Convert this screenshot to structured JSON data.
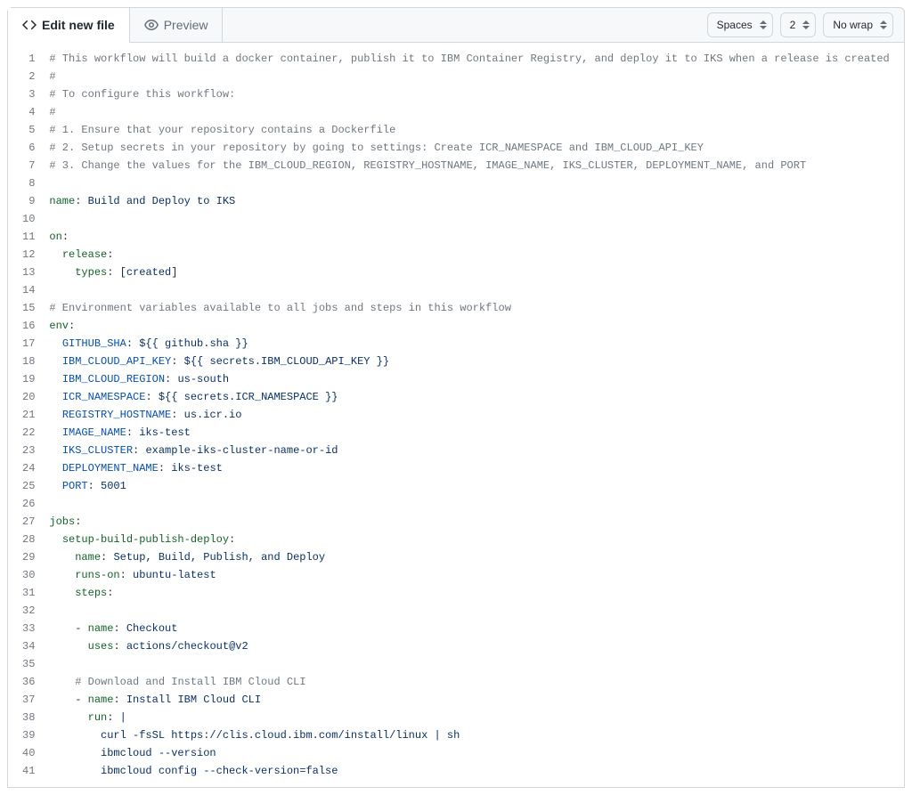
{
  "toolbar": {
    "editTab": "Edit new file",
    "previewTab": "Preview",
    "indentMode": "Spaces",
    "indentSize": "2",
    "wrapMode": "No wrap"
  },
  "code": {
    "lines": [
      [
        [
          "comment",
          "# This workflow will build a docker container, publish it to IBM Container Registry, and deploy it to IKS when a release is created"
        ]
      ],
      [
        [
          "comment",
          "#"
        ]
      ],
      [
        [
          "comment",
          "# To configure this workflow:"
        ]
      ],
      [
        [
          "comment",
          "#"
        ]
      ],
      [
        [
          "comment",
          "# 1. Ensure that your repository contains a Dockerfile"
        ]
      ],
      [
        [
          "comment",
          "# 2. Setup secrets in your repository by going to settings: Create ICR_NAMESPACE and IBM_CLOUD_API_KEY"
        ]
      ],
      [
        [
          "comment",
          "# 3. Change the values for the IBM_CLOUD_REGION, REGISTRY_HOSTNAME, IMAGE_NAME, IKS_CLUSTER, DEPLOYMENT_NAME, and PORT"
        ]
      ],
      [],
      [
        [
          "key",
          "name"
        ],
        [
          "punc",
          ": "
        ],
        [
          "str",
          "Build and Deploy to IKS"
        ]
      ],
      [],
      [
        [
          "key",
          "on"
        ],
        [
          "punc",
          ":"
        ]
      ],
      [
        [
          "punc",
          "  "
        ],
        [
          "key",
          "release"
        ],
        [
          "punc",
          ":"
        ]
      ],
      [
        [
          "punc",
          "    "
        ],
        [
          "key",
          "types"
        ],
        [
          "punc",
          ": ["
        ],
        [
          "str",
          "created"
        ],
        [
          "punc",
          "]"
        ]
      ],
      [],
      [
        [
          "comment",
          "# Environment variables available to all jobs and steps in this workflow"
        ]
      ],
      [
        [
          "key",
          "env"
        ],
        [
          "punc",
          ":"
        ]
      ],
      [
        [
          "punc",
          "  "
        ],
        [
          "var",
          "GITHUB_SHA"
        ],
        [
          "punc",
          ": "
        ],
        [
          "str",
          "${{ github.sha }}"
        ]
      ],
      [
        [
          "punc",
          "  "
        ],
        [
          "var",
          "IBM_CLOUD_API_KEY"
        ],
        [
          "punc",
          ": "
        ],
        [
          "str",
          "${{ secrets.IBM_CLOUD_API_KEY }}"
        ]
      ],
      [
        [
          "punc",
          "  "
        ],
        [
          "var",
          "IBM_CLOUD_REGION"
        ],
        [
          "punc",
          ": "
        ],
        [
          "str",
          "us-south"
        ]
      ],
      [
        [
          "punc",
          "  "
        ],
        [
          "var",
          "ICR_NAMESPACE"
        ],
        [
          "punc",
          ": "
        ],
        [
          "str",
          "${{ secrets.ICR_NAMESPACE }}"
        ]
      ],
      [
        [
          "punc",
          "  "
        ],
        [
          "var",
          "REGISTRY_HOSTNAME"
        ],
        [
          "punc",
          ": "
        ],
        [
          "str",
          "us.icr.io"
        ]
      ],
      [
        [
          "punc",
          "  "
        ],
        [
          "var",
          "IMAGE_NAME"
        ],
        [
          "punc",
          ": "
        ],
        [
          "str",
          "iks-test"
        ]
      ],
      [
        [
          "punc",
          "  "
        ],
        [
          "var",
          "IKS_CLUSTER"
        ],
        [
          "punc",
          ": "
        ],
        [
          "str",
          "example-iks-cluster-name-or-id"
        ]
      ],
      [
        [
          "punc",
          "  "
        ],
        [
          "var",
          "DEPLOYMENT_NAME"
        ],
        [
          "punc",
          ": "
        ],
        [
          "str",
          "iks-test"
        ]
      ],
      [
        [
          "punc",
          "  "
        ],
        [
          "var",
          "PORT"
        ],
        [
          "punc",
          ": "
        ],
        [
          "str",
          "5001"
        ]
      ],
      [],
      [
        [
          "key",
          "jobs"
        ],
        [
          "punc",
          ":"
        ]
      ],
      [
        [
          "punc",
          "  "
        ],
        [
          "key",
          "setup-build-publish-deploy"
        ],
        [
          "punc",
          ":"
        ]
      ],
      [
        [
          "punc",
          "    "
        ],
        [
          "key",
          "name"
        ],
        [
          "punc",
          ": "
        ],
        [
          "str",
          "Setup, Build, Publish, and Deploy"
        ]
      ],
      [
        [
          "punc",
          "    "
        ],
        [
          "key",
          "runs-on"
        ],
        [
          "punc",
          ": "
        ],
        [
          "str",
          "ubuntu-latest"
        ]
      ],
      [
        [
          "punc",
          "    "
        ],
        [
          "key",
          "steps"
        ],
        [
          "punc",
          ":"
        ]
      ],
      [],
      [
        [
          "punc",
          "    - "
        ],
        [
          "key",
          "name"
        ],
        [
          "punc",
          ": "
        ],
        [
          "str",
          "Checkout"
        ]
      ],
      [
        [
          "punc",
          "      "
        ],
        [
          "key",
          "uses"
        ],
        [
          "punc",
          ": "
        ],
        [
          "str",
          "actions/checkout@v2"
        ]
      ],
      [],
      [
        [
          "punc",
          "    "
        ],
        [
          "comment",
          "# Download and Install IBM Cloud CLI"
        ]
      ],
      [
        [
          "punc",
          "    - "
        ],
        [
          "key",
          "name"
        ],
        [
          "punc",
          ": "
        ],
        [
          "str",
          "Install IBM Cloud CLI"
        ]
      ],
      [
        [
          "punc",
          "      "
        ],
        [
          "key",
          "run"
        ],
        [
          "punc",
          ": "
        ],
        [
          "str",
          "|"
        ]
      ],
      [
        [
          "punc",
          "        "
        ],
        [
          "str",
          "curl -fsSL https://clis.cloud.ibm.com/install/linux | sh"
        ]
      ],
      [
        [
          "punc",
          "        "
        ],
        [
          "str",
          "ibmcloud --version"
        ]
      ],
      [
        [
          "punc",
          "        "
        ],
        [
          "str",
          "ibmcloud config --check-version=false"
        ]
      ]
    ]
  }
}
